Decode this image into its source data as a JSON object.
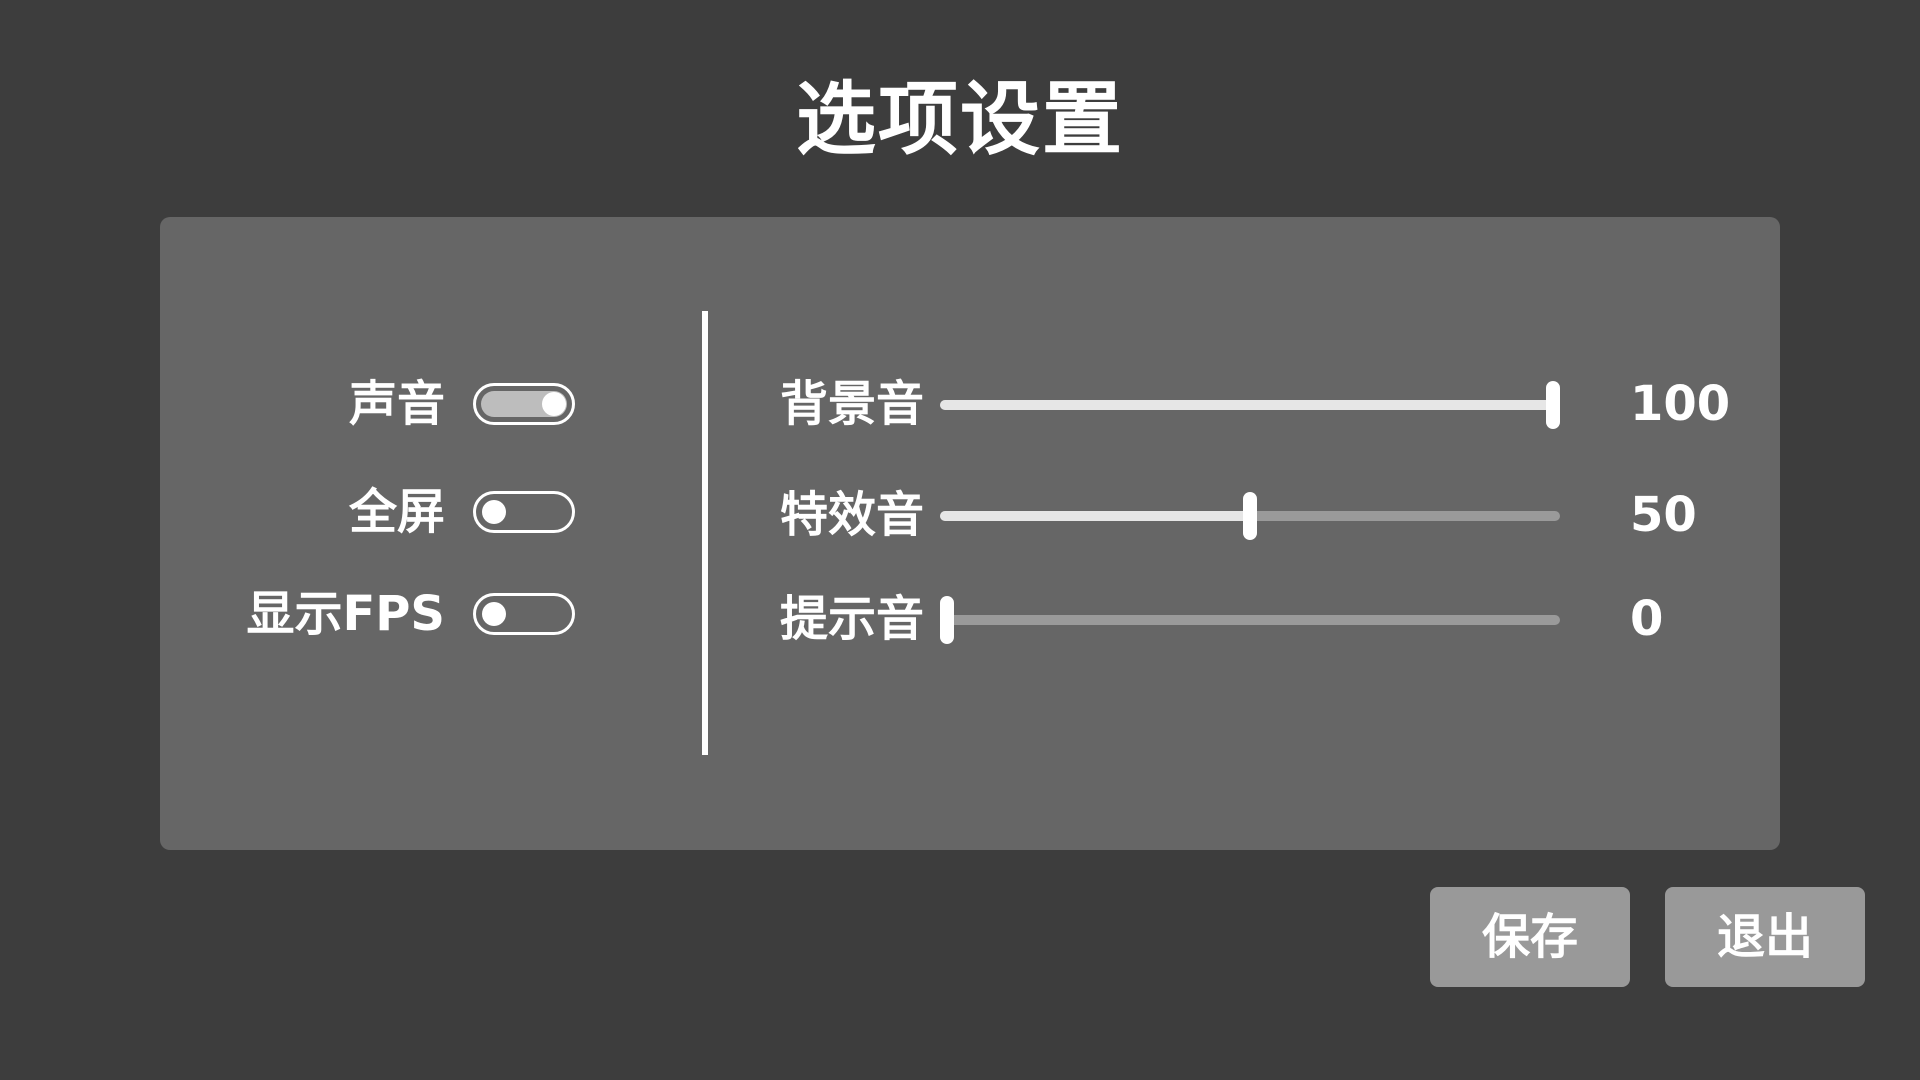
{
  "title": "选项设置",
  "toggles": [
    {
      "label": "声音",
      "on": true
    },
    {
      "label": "全屏",
      "on": false
    },
    {
      "label": "显示FPS",
      "on": false
    }
  ],
  "sliders": [
    {
      "label": "背景音",
      "value": 100,
      "value_text": "100",
      "min": 0,
      "max": 100
    },
    {
      "label": "特效音",
      "value": 50,
      "value_text": "50",
      "min": 0,
      "max": 100
    },
    {
      "label": "提示音",
      "value": 0,
      "value_text": "0",
      "min": 0,
      "max": 100
    }
  ],
  "buttons": {
    "save_label": "保存",
    "exit_label": "退出"
  },
  "colors": {
    "background": "#3d3d3d",
    "panel": "#666666",
    "button": "#999999",
    "text": "#ffffff",
    "toggle_on_track": "#bdbdbd",
    "slider_track": "#9a9a9a",
    "slider_fill": "#e6e6e6"
  }
}
